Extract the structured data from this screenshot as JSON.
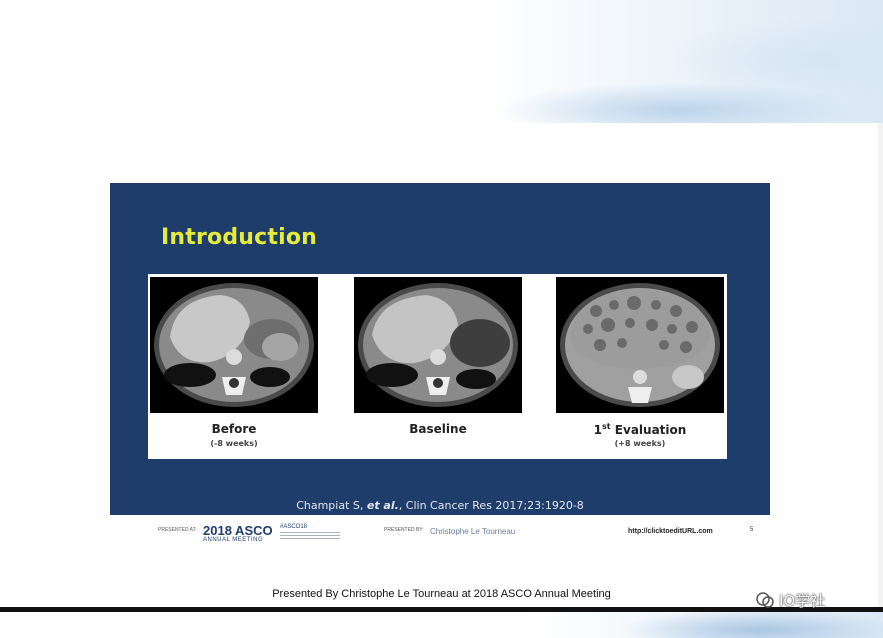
{
  "slide": {
    "title": "Introduction",
    "panels": [
      {
        "label": "Before",
        "sub": "(-8 weeks)"
      },
      {
        "label": "Baseline",
        "sub": ""
      },
      {
        "label": "1",
        "label_sup": "st",
        "label_rest": " Evaluation",
        "sub": "(+8 weeks)"
      }
    ],
    "citation_author": "Champiat S, ",
    "citation_etal": "et al.",
    "citation_rest": ", Clin Cancer Res 2017;23:1920-8"
  },
  "footer": {
    "presented_at": "PRESENTED AT:",
    "asco": "2018 ASCO",
    "asco_sub": "ANNUAL MEETING",
    "hashtag": "#ASCO18",
    "presented_by": "PRESENTED BY:",
    "presenter": "Christophe Le Tourneau",
    "url": "http://clicktoeditURL.com",
    "page": "5"
  },
  "caption": "Presented By Christophe Le Tourneau at 2018 ASCO Annual Meeting",
  "watermark": "IO学社",
  "colors": {
    "slide_bg": "#1f3d6b",
    "title": "#e6ec3c"
  }
}
